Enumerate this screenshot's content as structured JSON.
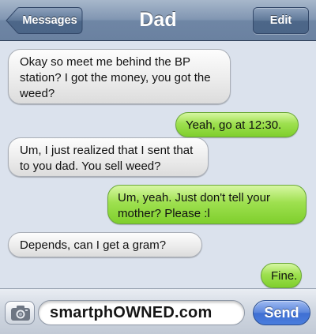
{
  "navbar": {
    "back_label": "Messages",
    "title": "Dad",
    "edit_label": "Edit"
  },
  "messages": [
    {
      "direction": "incoming",
      "text": "Okay so meet me behind the BP station? I got the money, you got the weed?"
    },
    {
      "direction": "outgoing",
      "text": "Yeah, go at 12:30."
    },
    {
      "direction": "incoming",
      "text": "Um, I just realized that I sent that to you dad. You sell weed?"
    },
    {
      "direction": "outgoing",
      "text": "Um, yeah. Just don't tell your mother? Please :l"
    },
    {
      "direction": "incoming",
      "text": "Depends, can I get a gram?"
    },
    {
      "direction": "outgoing",
      "text": "Fine."
    }
  ],
  "input_bar": {
    "camera_icon": "camera-icon",
    "field_text": "smartphOWNED.com",
    "send_label": "Send"
  },
  "colors": {
    "incoming_bubble": "#e9e9e9",
    "outgoing_bubble": "#8fd63d",
    "background": "#dbe2ed",
    "navbar": "#7a90ad",
    "send_button": "#4a7ddd"
  }
}
